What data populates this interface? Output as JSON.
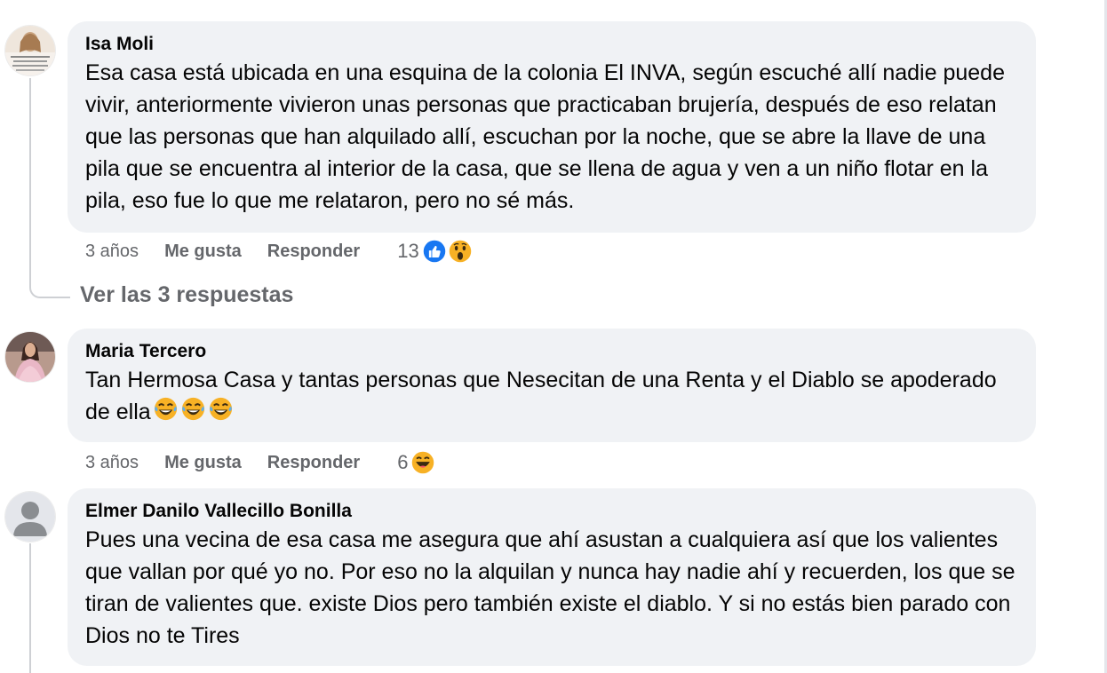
{
  "comments": [
    {
      "author": "Isa Moli",
      "text": "Esa casa está ubicada en una esquina de la colonia El INVA, según escuché allí nadie puede vivir, anteriormente vivieron unas personas que practicaban brujería, después de eso relatan que las personas que han alquilado allí, escuchan por la noche, que se abre la llave de una pila que se encuentra al interior de la casa, que se llena de agua y ven a un niño flotar en la pila, eso fue lo que me relataron, pero no sé más.",
      "time": "3 años",
      "like_label": "Me gusta",
      "reply_label": "Responder",
      "reaction_count": "13",
      "reactions": [
        "like-icon",
        "wow-icon"
      ],
      "view_replies": "Ver las 3 respuestas"
    },
    {
      "author": "Maria Tercero",
      "text": "Tan Hermosa Casa y tantas personas que Nesecitan de una Renta y el Diablo se apoderado de ella",
      "text_emojis": [
        "laughing-tears-emoji",
        "laughing-tears-emoji",
        "laughing-tears-emoji"
      ],
      "time": "3 años",
      "like_label": "Me gusta",
      "reply_label": "Responder",
      "reaction_count": "6",
      "reactions": [
        "haha-icon"
      ]
    },
    {
      "author": "Elmer Danilo Vallecillo Bonilla",
      "text": "Pues una vecina de esa casa me asegura que ahí asustan a cualquiera así que los valientes que vallan por qué yo no. Por eso no la alquilan y nunca hay nadie ahí y recuerden, los que se tiran de valientes que. existe Dios pero también existe el diablo. Y si no estás bien parado con Dios no te Tires"
    }
  ],
  "colors": {
    "bubble": "#f0f2f5",
    "meta_text": "#65676b",
    "like_blue": "#1877f2",
    "emoji_yellow": "#f7b125"
  }
}
